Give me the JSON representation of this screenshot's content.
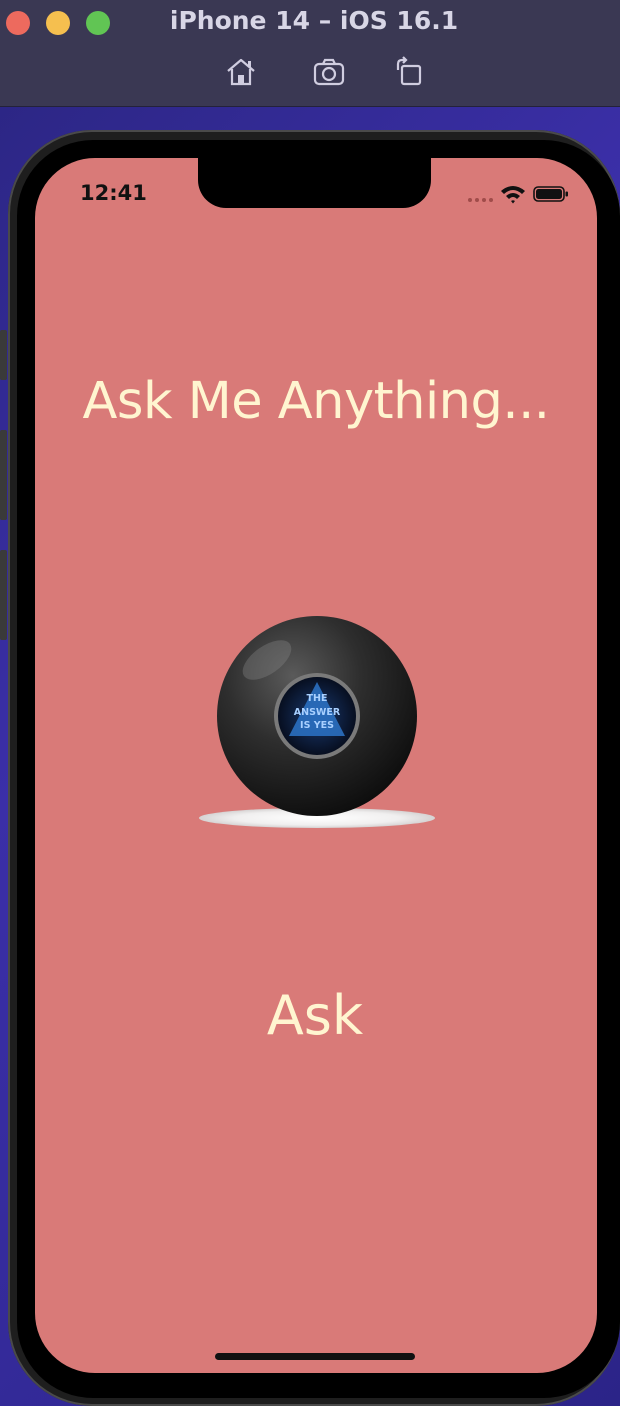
{
  "window": {
    "title": "iPhone 14 – iOS 16.1",
    "toolbar_icons": [
      "home-icon",
      "screenshot-icon",
      "rotate-icon"
    ]
  },
  "status_bar": {
    "time": "12:41",
    "icons": [
      "signal-icon",
      "wifi-icon",
      "battery-icon"
    ]
  },
  "app": {
    "background_color": "#d97a78",
    "text_color": "#fff5d0",
    "headline": "Ask Me Anything...",
    "ball_image": {
      "icon": "magic-8-ball-image",
      "answer_lines": [
        "THE",
        "ANSWER",
        "IS YES"
      ]
    },
    "ask_button_label": "Ask"
  }
}
